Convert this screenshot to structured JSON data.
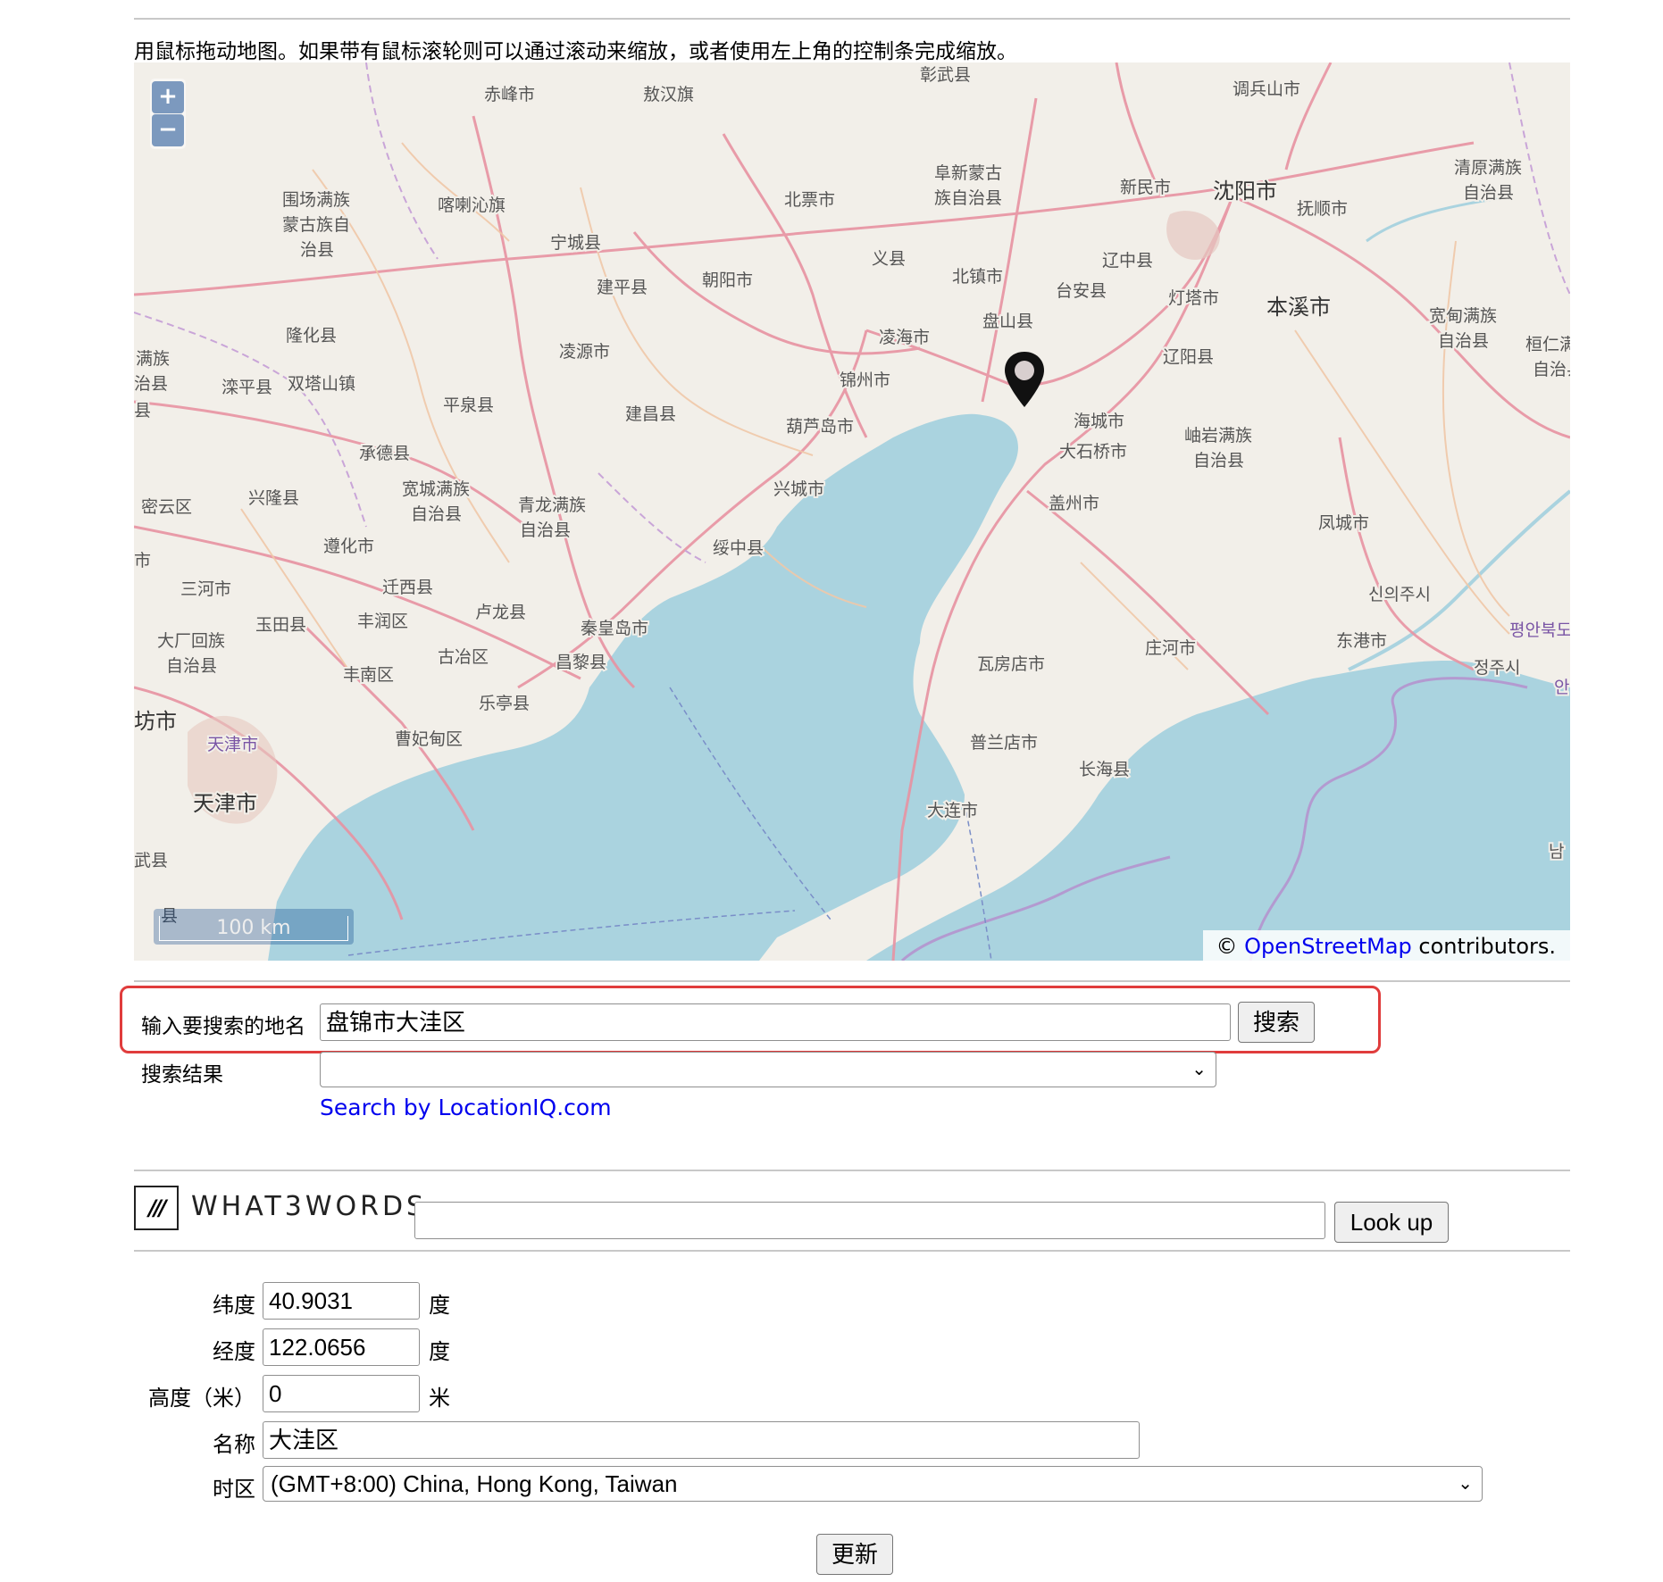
{
  "intro_text": "用鼠标拖动地图。如果带有鼠标滚轮则可以通过滚动来缩放，或者使用左上角的控制条完成缩放。",
  "map": {
    "zoom_in": "+",
    "zoom_out": "−",
    "scale_label": "100 km",
    "attribution_prefix": "©",
    "attribution_link": "OpenStreetMap",
    "attribution_suffix": "contributors.",
    "marker_icon": "map-pin-icon",
    "labels": {
      "zhangwu": "彰武县",
      "tiaobingshan": "调兵山市",
      "chifeng": "赤峰市",
      "aohan": "敖汉旗",
      "weichang1": "围场满族",
      "weichang2": "蒙古族自",
      "weichang3": "治县",
      "harqin": "喀喇沁旗",
      "beipiao": "北票市",
      "fuxin1": "阜新蒙古",
      "fuxin2": "族自治县",
      "xinmin": "新民市",
      "shenyang": "沈阳市",
      "fushun": "抚顺市",
      "qingyuan1": "清原满族",
      "qingyuan2": "自治县",
      "ningcheng": "宁城县",
      "yixian": "义县",
      "liaozhong": "辽中县",
      "jianping": "建平县",
      "chaoyang": "朝阳市",
      "beizhen": "北镇市",
      "taian": "台安县",
      "dengta": "灯塔市",
      "benxi": "本溪市",
      "kuandian1": "宽甸满族",
      "kuandian2": "自治县",
      "huanren1": "桓仁满",
      "huanren2": "自治县",
      "longhua": "隆化县",
      "panshan": "盘山县",
      "linghai": "凌海市",
      "lingyuan": "凌源市",
      "liaoyang": "辽阳县",
      "manzu1": "满族",
      "manzu2": "治县",
      "luanping": "滦平县",
      "shuangtashan": "双塔山镇",
      "jinzhou": "锦州市",
      "pingquan": "平泉县",
      "jianchang": "建昌县",
      "huludao": "葫芦岛市",
      "haicheng": "海城市",
      "xiuyan1": "岫岩满族",
      "xiuyan2": "自治县",
      "chengde": "承德县",
      "dashiqiao": "大石桥市",
      "miyun": "密云区",
      "xinglong": "兴隆县",
      "kuancheng1": "宽城满族",
      "kuancheng2": "自治县",
      "qinglong1": "青龙满族",
      "qinglong2": "自治县",
      "xingcheng": "兴城市",
      "gaizhou": "盖州市",
      "fengcheng": "凤城市",
      "zunhua": "遵化市",
      "suizhong": "绥中县",
      "sanhe": "三河市",
      "qianxi": "迁西县",
      "sinuiju": "신의주시",
      "lulong": "卢龙县",
      "pyongbuk": "평안북도",
      "yutian": "玉田县",
      "fengrun": "丰润区",
      "qinhuangdao": "秦皇岛市",
      "dachang1": "大厂回族",
      "dachang2": "自治县",
      "guye": "古冶区",
      "changli": "昌黎县",
      "donggang": "东港市",
      "zhuanghe": "庄河市",
      "wafangdian": "瓦房店市",
      "jeongju": "정주시",
      "fengnan": "丰南区",
      "laoting": "乐亭县",
      "langfang": "坊市",
      "caofeidian": "曹妃甸区",
      "tianjin_province": "天津市",
      "pulandian": "普兰店市",
      "changhai": "长海县",
      "tianjin": "天津市",
      "dalian": "大连市",
      "wuqing": "武县",
      "bao": "县",
      "yixian_w": "县",
      "ko_an": "안",
      "ko_nam": "남",
      "shi": "市"
    }
  },
  "search": {
    "label": "输入要搜索的地名",
    "value": "盘锦市大洼区",
    "button": "搜索",
    "results_label": "搜索结果",
    "results_selected": "",
    "provider_link": "Search by LocationIQ.com"
  },
  "w3w": {
    "logo": "///",
    "name": "WHAT3WORDS",
    "value": "",
    "button": "Look up"
  },
  "form": {
    "lat_label": "纬度",
    "lat_value": "40.9031",
    "lat_unit": "度",
    "lng_label": "经度",
    "lng_value": "122.0656",
    "lng_unit": "度",
    "alt_label": "高度（米）",
    "alt_value": "0",
    "alt_unit": "米",
    "name_label": "名称",
    "name_value": "大洼区",
    "tz_label": "时区",
    "tz_value": "(GMT+8:00) China, Hong Kong, Taiwan",
    "update_button": "更新"
  },
  "colors": {
    "land": "#f2efe9",
    "sea": "#aad3df",
    "road": "#e892a2",
    "minor_road": "#f0c8a8",
    "border": "#b58ccc",
    "highlight": "#e03c3c",
    "link": "#0000ee"
  }
}
